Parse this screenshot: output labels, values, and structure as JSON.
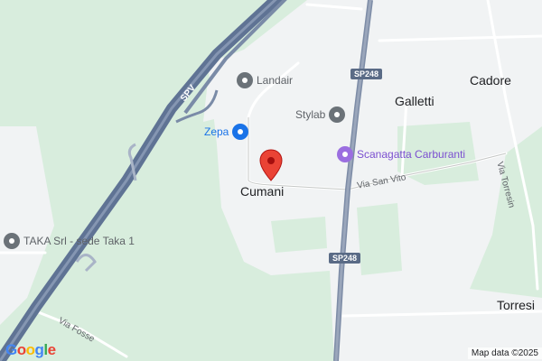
{
  "map": {
    "places": [
      {
        "name": "Cumani"
      },
      {
        "name": "Galletti"
      },
      {
        "name": "Cadore"
      },
      {
        "name": "Torresi"
      }
    ],
    "pois": [
      {
        "name": "Landair",
        "icon": "place-pin-icon"
      },
      {
        "name": "Stylab",
        "icon": "place-pin-icon"
      },
      {
        "name": "Zepa",
        "icon": "shopping-bag-icon"
      },
      {
        "name": "Scanagatta Carburanti",
        "icon": "fuel-station-icon"
      },
      {
        "name": "TAKA Srl - sede Taka 1",
        "icon": "place-pin-icon"
      }
    ],
    "roads": {
      "spv": "SPV",
      "via_san_vito": "Via San Vito",
      "via_torresin": "Via Torresin",
      "via_fosse": "Via Fosse",
      "sp248_top": "SP248",
      "sp248_bottom": "SP248"
    },
    "logo": {
      "letters": [
        "G",
        "o",
        "o",
        "g",
        "l",
        "e"
      ],
      "colors": [
        "#4285f4",
        "#ea4335",
        "#fbbc05",
        "#4285f4",
        "#34a853",
        "#ea4335"
      ]
    },
    "attribution": "Map data ©2025",
    "colors": {
      "land": "#d8eddd",
      "urban": "#f1f3f4",
      "highway": "#6b7f9e",
      "marker": "#ea4335"
    }
  }
}
